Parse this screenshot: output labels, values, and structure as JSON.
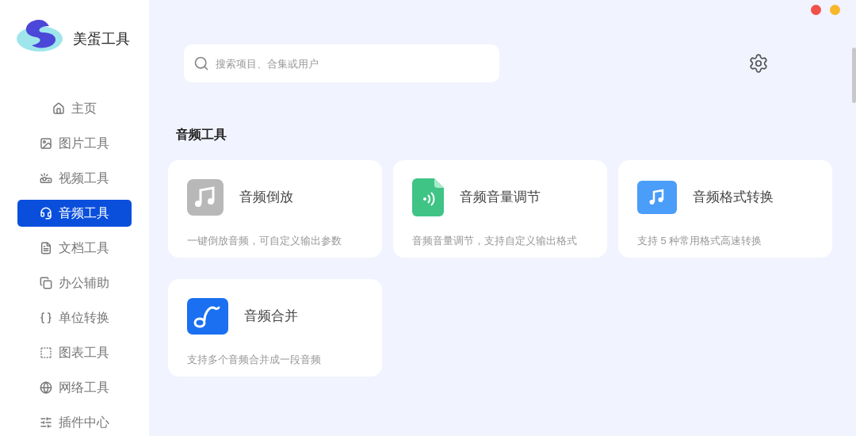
{
  "app": {
    "name": "美蛋工具"
  },
  "sidebar": {
    "items": [
      {
        "label": "主页",
        "selected": false
      },
      {
        "label": "图片工具",
        "selected": false
      },
      {
        "label": "视频工具",
        "selected": false
      },
      {
        "label": "音频工具",
        "selected": true
      },
      {
        "label": "文档工具",
        "selected": false
      },
      {
        "label": "办公辅助",
        "selected": false
      },
      {
        "label": "单位转换",
        "selected": false
      },
      {
        "label": "图表工具",
        "selected": false
      },
      {
        "label": "网络工具",
        "selected": false
      },
      {
        "label": "插件中心",
        "selected": false
      }
    ]
  },
  "search": {
    "placeholder": "搜索项目、合集或用户"
  },
  "section": {
    "title": "音频工具"
  },
  "cards": [
    {
      "title": "音频倒放",
      "description": "一键倒放音频，可自定义输出参数"
    },
    {
      "title": "音频音量调节",
      "description": "音频音量调节，支持自定义输出格式"
    },
    {
      "title": "音频格式转换",
      "description": "支持 5 种常用格式高速转换"
    },
    {
      "title": "音频合并",
      "description": "支持多个音频合并成一段音频"
    }
  ]
}
